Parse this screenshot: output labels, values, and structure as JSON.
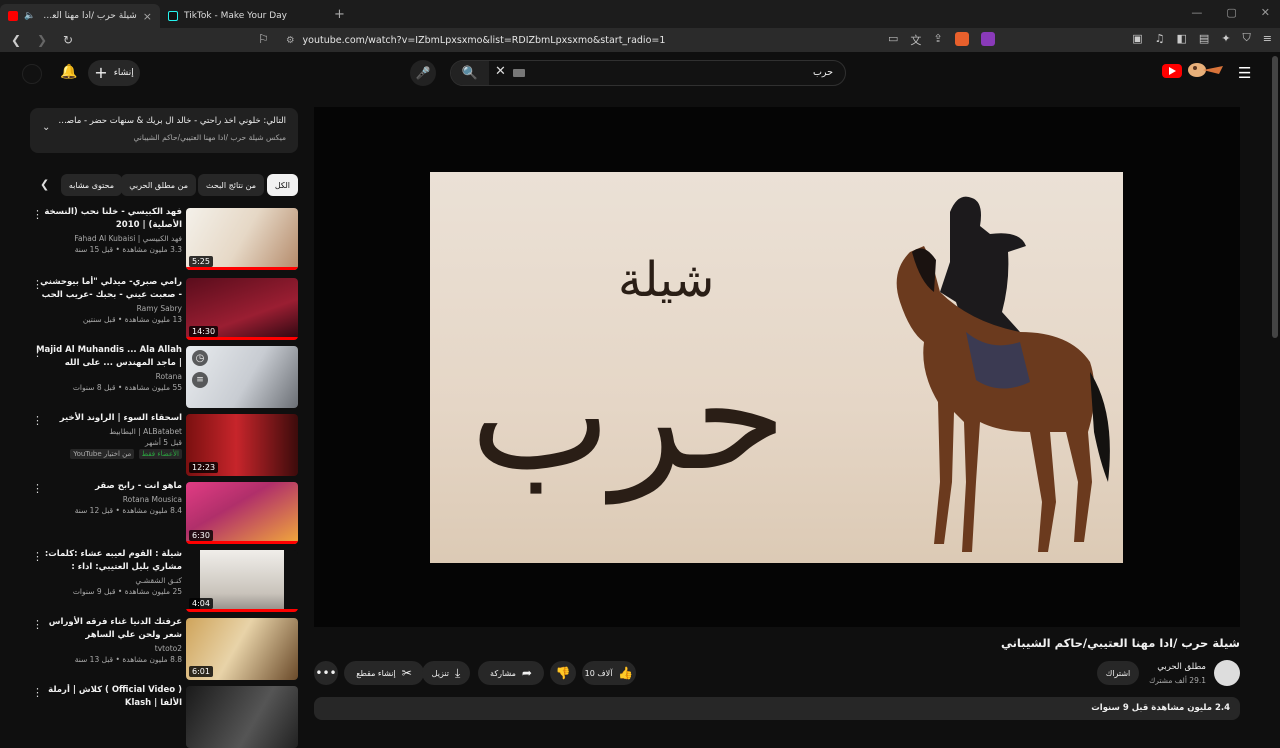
{
  "browser": {
    "tabs": [
      {
        "title": "شيلة حرب /ادا مهنا العتيبي/حاك",
        "active": true,
        "close": "×"
      },
      {
        "title": "TikTok - Make Your Day",
        "active": false,
        "close": "×"
      }
    ],
    "new_tab": "+",
    "url": "youtube.com/watch?v=IZbmLpxsxmo&list=RDIZbmLpxsxmo&start_radio=1"
  },
  "yt_header": {
    "create_label": "إنشاء",
    "search_query": "حرب"
  },
  "up_next": {
    "title": "التالي: خلوني اخذ راحتي - خالد ال بريك & سنهات حضر - ماصحب من ...",
    "subtitle": "ميكس شيلة حرب /ادا مهنا العتيبي/حاكم الشيباني"
  },
  "chips": [
    "الكل",
    "من نتائج البحث",
    "من مطلق الحربي",
    "محتوى مشابه"
  ],
  "playlist": [
    {
      "title": "فهد الكبيسي - خلنا نحب (النسخة الأصلية) | 2010",
      "channel": "فهد الكبيسي | Fahad Al Kubaisi",
      "stats": "3.3 مليون مشاهدة • قبل 15 سنة",
      "duration": "5:25"
    },
    {
      "title": "رامي صبري- ميدلي \"أما بيوحشني - صعبت عيني - بحبك -عريب الحب - مش ...",
      "channel": "Ramy Sabry",
      "stats": "13 مليون مشاهدة • قبل سنتين",
      "duration": "14:30"
    },
    {
      "title": "Majid Al Muhandis ... Ala Allah | ماجد المهندس ... على الله",
      "channel": "Rotana",
      "stats": "55 مليون مشاهدة • قبل 8 سنوات",
      "duration": ""
    },
    {
      "title": "اسحقاء السوء | الراوند الأخير",
      "channel": "ALBatabet | البطابيط",
      "stats": "قبل 5 أشهر",
      "duration": "12:23",
      "badge1": "من اختيار YouTube",
      "badge2": "الأعضاء فقط"
    },
    {
      "title": "ماهو انت - رابح صقر",
      "channel": "Rotana Mousica",
      "stats": "8.4 مليون مشاهدة • قبل 12 سنة",
      "duration": "6:30"
    },
    {
      "title": "شيلة : القوم لعيبه عشاء :كلمات: مشاري بليل العتيبي: اداء : عبدالعزيز اليامي",
      "channel": "كنـق الشقشـي",
      "stats": "25 مليون مشاهدة • قبل 9 سنوات",
      "duration": "4:04"
    },
    {
      "title": "عرفتك الدنيا غناء فرقه الأوراس شعر ولحن علي الساهر",
      "channel": "tvtoto2",
      "stats": "8.8 مليون مشاهدة • قبل 13 سنة",
      "duration": "6:01"
    },
    {
      "title": "( Official Video ) كلاش | أرملة الألفا | Klash",
      "channel": "",
      "stats": "",
      "duration": ""
    }
  ],
  "video": {
    "frame_small_text": "شيلة",
    "frame_big_text": "حرب",
    "title": "شيلة حرب /ادا مهنا العتيبي/حاكم الشيباني",
    "channel": "مطلق الحربي",
    "subscribers": "29.1 ألف مشترك",
    "subscribe_label": "اشتراك",
    "likes": "10 آلاف",
    "share": "مشاركة",
    "download": "تنزيل",
    "clip": "إنشاء مقطع",
    "desc_line": "2.4 مليون مشاهدة  قبل 9 سنوات"
  }
}
